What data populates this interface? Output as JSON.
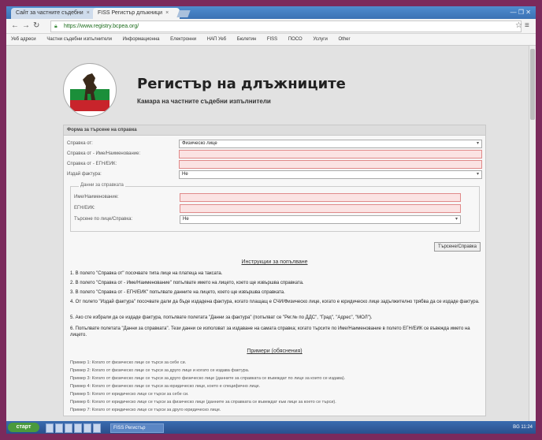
{
  "browser": {
    "tabs": [
      {
        "label": "Сайт за частните съдебни"
      },
      {
        "label": "FISS Регистър длъжници"
      }
    ],
    "window_controls": "—  ❐  ✕",
    "address": "https://www.registry.bcpea.org/",
    "bookmarks": [
      "Уеб адреси",
      "Частни съдебни изпълнители",
      "Информационна",
      "Електронни",
      "НАП Уеб",
      "Бюлетин",
      "FISS",
      "ПОСО",
      "Услуги",
      "Other"
    ]
  },
  "site": {
    "title": "Регистър на длъжниците",
    "subtitle": "Камара на частните съдебни изпълнители"
  },
  "form": {
    "panel_title": "Форма за търсене на справка",
    "rows": [
      {
        "label": "Справка от:",
        "value": "Физическо лице"
      },
      {
        "label": "Справка от - Име/Наименование:",
        "value": ""
      },
      {
        "label": "Справка от - ЕГН/ЕИК:",
        "value": ""
      },
      {
        "label": "Издай фактура:",
        "value": "Не"
      }
    ],
    "fieldset_legend": "Данни за справката",
    "sub_rows": [
      {
        "label": "Име/Наименование:",
        "value": ""
      },
      {
        "label": "ЕГН/ЕИК:",
        "value": ""
      },
      {
        "label": "Търсене по лице/Справка:",
        "value": "Не"
      }
    ],
    "search_button": "Търсене/Справка"
  },
  "instructions": {
    "title": "Инструкции за попълване",
    "items": [
      "1. В полето \"Справка от\" посочвате типа лице на платеца на таксата.",
      "2. В полето \"Справка от - Име/Наименование\" попълвате името на лицето, което ще извършва справката.",
      "3. В полето \"Справка от - ЕГН/ЕИК\" попълвате данните на лицето, което ще извършва справката.",
      "4. От полето \"Издай фактура\" посочвате дали да бъде издадена фактура, когато плащащ е СЧИ/Физическо лице, когато е юридическо лице задължително трябва да се издаде фактура.",
      "5. Ако сте избрали да се издаде фактура, попълвате полетата \"Данни за фактура\" (попълват се \"Рег.№ по ДДС\", \"Град\", \"Адрес\", \"МОЛ\").",
      "6. Попълвате полетата \"Данни за справката\". Тези данни се използват за издаване на самата справка; когато търсите по Име/Наименование в полето ЕГН/ЕИК се въвежда името на лицето."
    ]
  },
  "examples": {
    "title": "Примери (обяснения)",
    "items": [
      "Пример 1: Когато от физическо лице се търси за себе си.",
      "Пример 2: Когато от физическо лице се търси за друго лице и когато се издава фактура.",
      "Пример 3: Когато от физическо лице се търси за друго физическо лице (данните за справката се въвеждат по лице за които се издава).",
      "Пример 4: Когато от физическо лице се търси за юридическо лице, което е специфично лице.",
      "Пример 5: Когато от юридическо лице се търси за себе си.",
      "Пример 6: Когато от юридическо лице се търси за физическо лице (данните за справката се въвеждат към лице за което се търси).",
      "Пример 7: Когато от юридическо лице се търси за друго юридическо лице."
    ]
  },
  "taskbar": {
    "start": "старт",
    "items": [
      "FISS Регистър"
    ],
    "tray": "BG  11:24"
  },
  "colors": {
    "accent": "#3b72b4",
    "required_field": "#fbe3e3",
    "frame": "#7b2a5c"
  }
}
